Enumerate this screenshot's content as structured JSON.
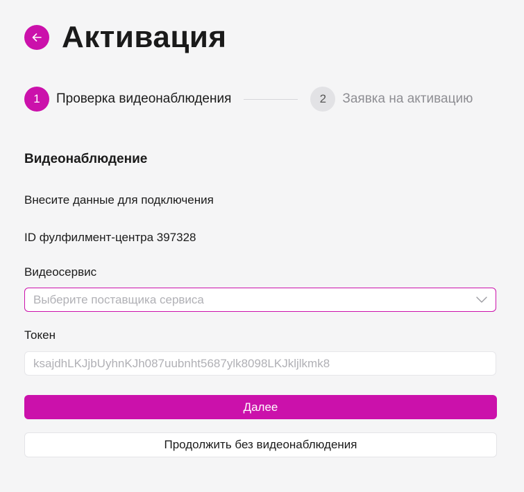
{
  "header": {
    "title": "Активация",
    "back_icon": "arrow-left-icon"
  },
  "stepper": {
    "steps": [
      {
        "number": "1",
        "label": "Проверка видеонаблюдения",
        "state": "active"
      },
      {
        "number": "2",
        "label": "Заявка на активацию",
        "state": "inactive"
      }
    ]
  },
  "form": {
    "section_title": "Видеонаблюдение",
    "instruction": "Внесите данные для подключения",
    "fulfillment_id": "ID фулфилмент-центра 397328",
    "video_service": {
      "label": "Видеосервис",
      "placeholder": "Выберите поставщика сервиса",
      "icon": "chevron-down-icon"
    },
    "token": {
      "label": "Токен",
      "placeholder": "ksajdhLKJjbUyhnKJh087uubnht5687ylk8098LKJkljlkmk8"
    }
  },
  "actions": {
    "next_label": "Далее",
    "skip_label": "Продолжить без видеонаблюдения"
  },
  "colors": {
    "accent": "#cb11ab",
    "background": "#f5f5f6",
    "inactive_step": "#e2e2e5"
  }
}
